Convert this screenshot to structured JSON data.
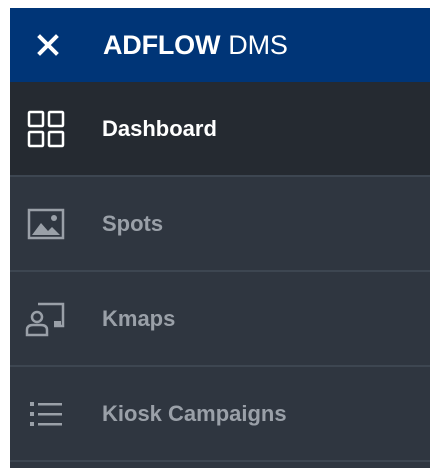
{
  "header": {
    "brand_bold": "ADFLOW",
    "brand_light": "DMS",
    "close_icon": "close-icon"
  },
  "nav": {
    "items": [
      {
        "label": "Dashboard",
        "icon": "dashboard-grid-icon",
        "active": true
      },
      {
        "label": "Spots",
        "icon": "image-icon",
        "active": false
      },
      {
        "label": "Kmaps",
        "icon": "user-screen-icon",
        "active": false
      },
      {
        "label": "Kiosk Campaigns",
        "icon": "list-icon",
        "active": false
      }
    ]
  },
  "colors": {
    "header_bg": "#003577",
    "sidebar_bg": "#2f3640",
    "active_bg": "#252a31",
    "active_text": "#ffffff",
    "inactive_text": "#9aa0a8"
  }
}
